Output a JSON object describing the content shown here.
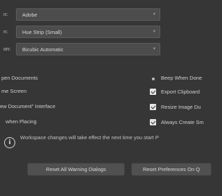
{
  "dropdowns": [
    {
      "label": "n:",
      "value": "Adobe"
    },
    {
      "label": "n:",
      "value": "Hue Strip (Small)"
    },
    {
      "label": "on:",
      "value": "Bicubic Automatic"
    }
  ],
  "options_left": [
    {
      "label": "pen Documents"
    },
    {
      "label": "me Screen"
    },
    {
      "label": "ew Document\" Interface"
    },
    {
      "label": "when Placing"
    }
  ],
  "options_right": [
    {
      "label": "Beep When Done",
      "checked": false
    },
    {
      "label": "Export Clipboard",
      "checked": true
    },
    {
      "label": "Resize Image Du",
      "checked": true
    },
    {
      "label": "Always Create Sm",
      "checked": true
    }
  ],
  "info": {
    "icon": "info-icon",
    "text": "Workspace changes will take effect the next time you start P"
  },
  "buttons": {
    "reset_warnings": "Reset All Warning Dialogs",
    "reset_preferences": "Reset Preferences On Q"
  },
  "colors": {
    "background": "#363636",
    "control": "#4c4c4c",
    "button": "#505050",
    "text": "#d2d2d2"
  }
}
